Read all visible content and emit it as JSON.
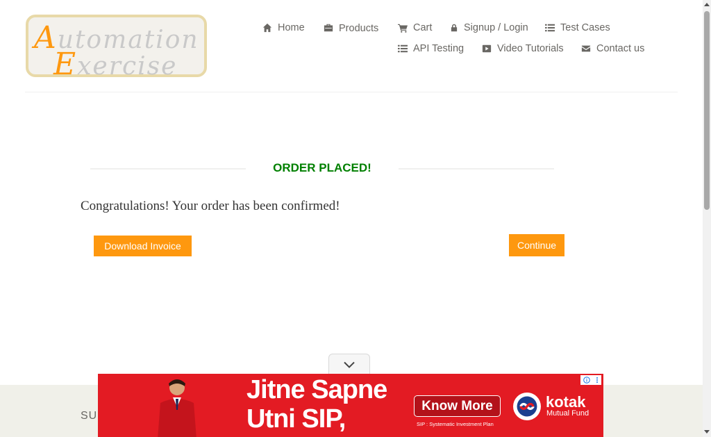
{
  "logo": {
    "line1_cap": "A",
    "line1_rest": "utomation",
    "line2_cap": "E",
    "line2_rest": "xercise"
  },
  "nav": {
    "home": {
      "label": "Home",
      "icon": "home-icon"
    },
    "products": {
      "label": "Products",
      "icon": "briefcase-icon"
    },
    "cart": {
      "label": "Cart",
      "icon": "cart-icon"
    },
    "signup": {
      "label": "Signup / Login",
      "icon": "lock-icon"
    },
    "test_cases": {
      "label": "Test Cases",
      "icon": "list-icon"
    },
    "api_testing": {
      "label": "API Testing",
      "icon": "list-icon"
    },
    "video_tutorials": {
      "label": "Video Tutorials",
      "icon": "youtube-play-icon"
    },
    "contact": {
      "label": "Contact us",
      "icon": "envelope-icon"
    }
  },
  "order": {
    "title": "ORDER PLACED!",
    "message": "Congratulations! Your order has been confirmed!",
    "download_label": "Download Invoice",
    "continue_label": "Continue"
  },
  "footer": {
    "subscription_partial": "SUB"
  },
  "ad": {
    "headline_line1": "Jitne Sapne",
    "headline_line2": "Utni SIP,",
    "cta": "Know More",
    "disclaimer": "SIP : Systematic Investment Plan",
    "brand": "kotak",
    "brand_sub": "Mutual Fund"
  },
  "colors": {
    "accent": "#fe980f",
    "success": "#008000",
    "ad_red": "#e31b23",
    "text": "#696763"
  }
}
